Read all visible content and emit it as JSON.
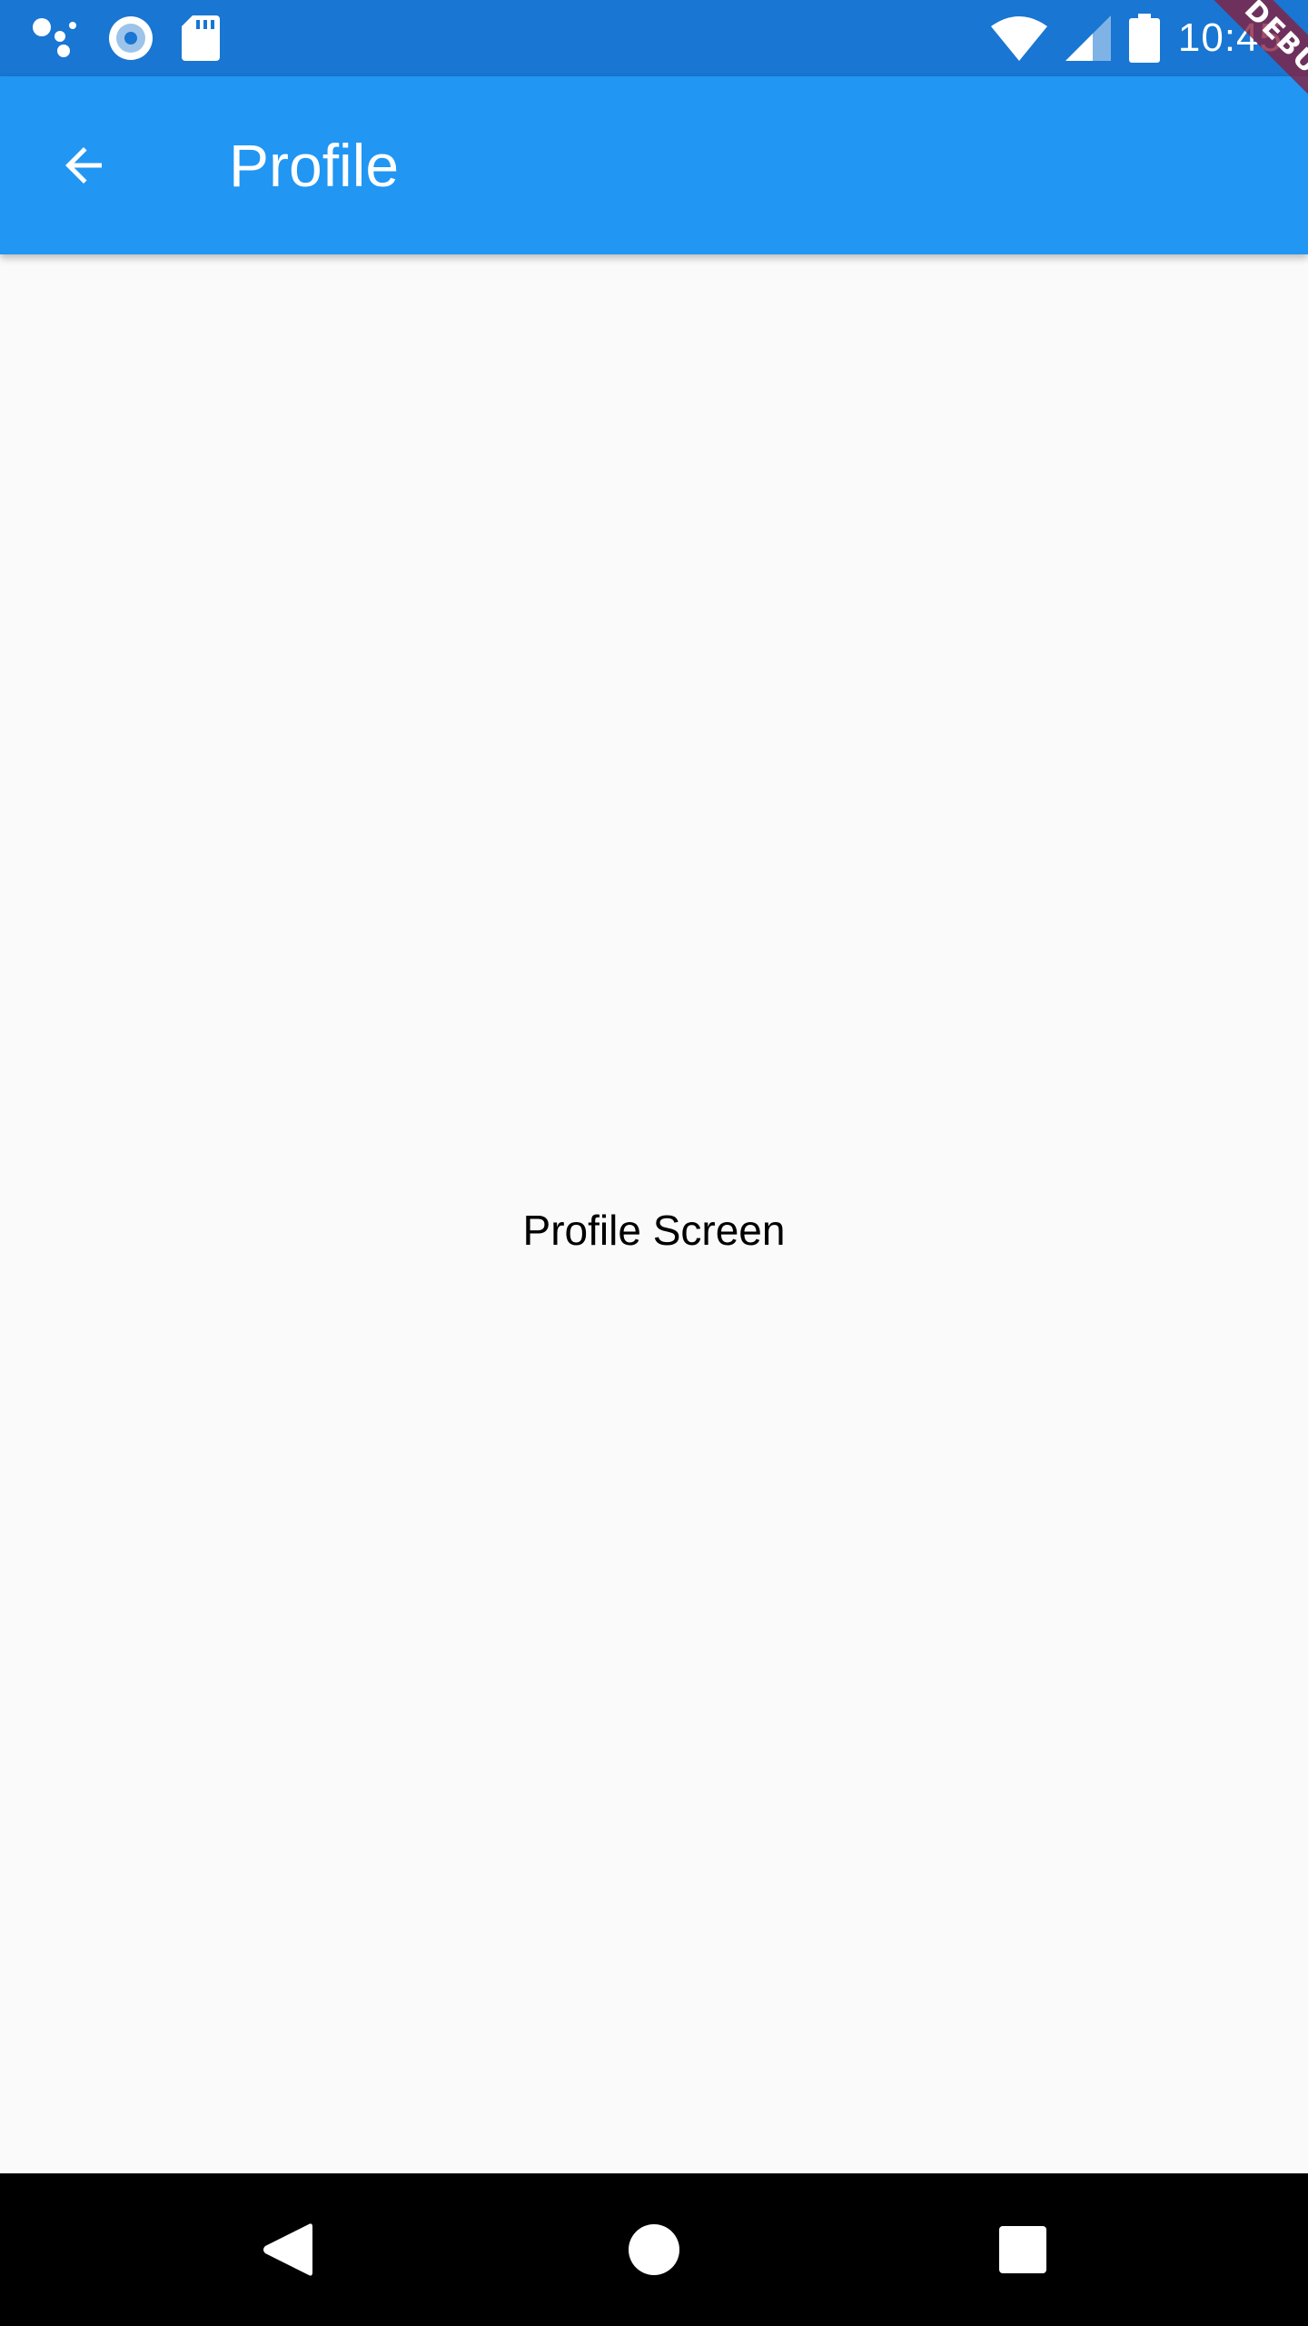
{
  "status_bar": {
    "time": "10:45",
    "left_icons": [
      "assistant-dots-icon",
      "record-circle-icon",
      "sd-card-icon"
    ],
    "right_icons": [
      "wifi-icon",
      "cell-signal-icon",
      "battery-icon"
    ]
  },
  "app_bar": {
    "title": "Profile",
    "back_icon": "arrow-back-icon"
  },
  "content": {
    "center_text": "Profile Screen"
  },
  "debug_banner": {
    "label": "DEBUG"
  },
  "nav_bar": {
    "buttons": [
      "back-triangle-icon",
      "home-circle-icon",
      "recents-square-icon"
    ]
  },
  "colors": {
    "status_bar": "#1976d2",
    "app_bar": "#2196f3",
    "background": "#fafafa",
    "nav_bar": "#000000",
    "debug_ribbon": "#861e3c"
  }
}
